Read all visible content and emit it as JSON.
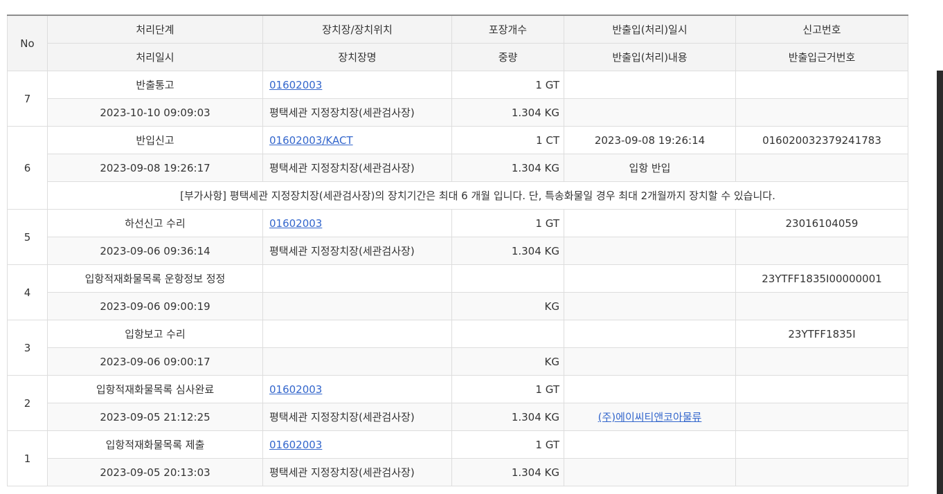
{
  "headers": {
    "row1": [
      "No",
      "처리단계",
      "장치장/장치위치",
      "포장개수",
      "반출입(처리)일시",
      "신고번호"
    ],
    "row2": [
      "처리일시",
      "장치장명",
      "중량",
      "반출입(처리)내용",
      "반출입근거번호"
    ]
  },
  "entries": [
    {
      "no": "7",
      "stage": "반출통고",
      "loc": "01602003",
      "loc_link": true,
      "pkg": "1 GT",
      "inout_time": "",
      "decl_no": "",
      "time": "2023-10-10 09:09:03",
      "wh_name": "평택세관 지정장치장(세관검사장)",
      "weight": "1.304 KG",
      "inout_content": "",
      "inout_content_link": false,
      "basis_no": ""
    },
    {
      "no": "6",
      "stage": "반입신고",
      "loc": "01602003/KACT",
      "loc_link": true,
      "pkg": "1 CT",
      "inout_time": "2023-09-08 19:26:14",
      "decl_no": "016020032379241783",
      "time": "2023-09-08 19:26:17",
      "wh_name": "평택세관 지정장치장(세관검사장)",
      "weight": "1.304 KG",
      "inout_content": "입항 반입",
      "inout_content_link": false,
      "basis_no": "",
      "note": "[부가사항] 평택세관 지정장치장(세관검사장)의 장치기간은 최대 6 개월 입니다. 단, 특송화물일 경우 최대 2개월까지 장치할 수 있습니다."
    },
    {
      "no": "5",
      "stage": "하선신고 수리",
      "loc": "01602003",
      "loc_link": true,
      "pkg": "1 GT",
      "inout_time": "",
      "decl_no": "23016104059",
      "time": "2023-09-06 09:36:14",
      "wh_name": "평택세관 지정장치장(세관검사장)",
      "weight": "1.304 KG",
      "inout_content": "",
      "inout_content_link": false,
      "basis_no": ""
    },
    {
      "no": "4",
      "stage": "입항적재화물목록 운항정보 정정",
      "loc": "",
      "loc_link": false,
      "pkg": "",
      "inout_time": "",
      "decl_no": "23YTFF1835I00000001",
      "time": "2023-09-06 09:00:19",
      "wh_name": "",
      "weight": "KG",
      "inout_content": "",
      "inout_content_link": false,
      "basis_no": ""
    },
    {
      "no": "3",
      "stage": "입항보고 수리",
      "loc": "",
      "loc_link": false,
      "pkg": "",
      "inout_time": "",
      "decl_no": "23YTFF1835I",
      "time": "2023-09-06 09:00:17",
      "wh_name": "",
      "weight": "KG",
      "inout_content": "",
      "inout_content_link": false,
      "basis_no": ""
    },
    {
      "no": "2",
      "stage": "입항적재화물목록 심사완료",
      "loc": "01602003",
      "loc_link": true,
      "pkg": "1 GT",
      "inout_time": "",
      "decl_no": "",
      "time": "2023-09-05 21:12:25",
      "wh_name": "평택세관 지정장치장(세관검사장)",
      "weight": "1.304 KG",
      "inout_content": "(주)에이씨티앤코아물류",
      "inout_content_link": true,
      "basis_no": ""
    },
    {
      "no": "1",
      "stage": "입항적재화물목록 제출",
      "loc": "01602003",
      "loc_link": true,
      "pkg": "1 GT",
      "inout_time": "",
      "decl_no": "",
      "time": "2023-09-05 20:13:03",
      "wh_name": "평택세관 지정장치장(세관검사장)",
      "weight": "1.304 KG",
      "inout_content": "",
      "inout_content_link": false,
      "basis_no": ""
    }
  ]
}
